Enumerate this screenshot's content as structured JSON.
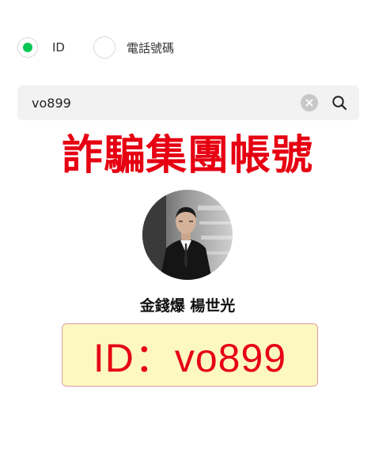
{
  "search_type": {
    "options": [
      {
        "label": "ID",
        "selected": true
      },
      {
        "label": "電話號碼",
        "selected": false
      }
    ],
    "selected_color": "#06c755"
  },
  "search": {
    "value": "vo899",
    "clear_icon": "clear-icon",
    "search_icon": "search-icon"
  },
  "banner": {
    "title": "詐騙集團帳號",
    "color": "#e60012"
  },
  "profile": {
    "name": "金錢爆 楊世光",
    "id_display": "ID：vo899",
    "id_box_background": "#fdf8c0"
  }
}
